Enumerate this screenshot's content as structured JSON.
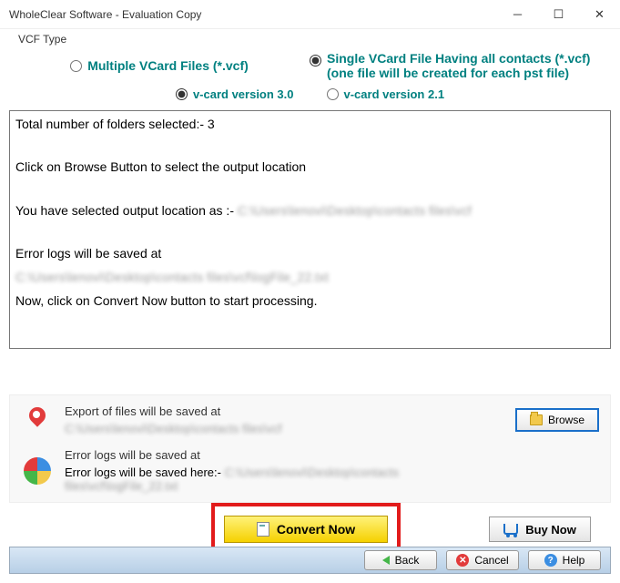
{
  "window": {
    "title": "WholeClear Software - Evaluation Copy"
  },
  "vcfType": {
    "groupLabel": "VCF Type",
    "multiple": "Multiple VCard Files (*.vcf)",
    "singleLine1": "Single VCard File Having all contacts (*.vcf)",
    "singleLine2": "(one file will be created for each pst file)"
  },
  "version": {
    "v30": "v-card version 3.0",
    "v21": "v-card version 2.1"
  },
  "log": {
    "l1": "Total number of folders selected:- 3",
    "l2": "Click on Browse Button to select the output location",
    "l3a": "You have selected output location as :- ",
    "l3b": "C:\\Users\\lenovi\\Desktop\\contacts files\\vcf",
    "l4": "Error logs will be saved at",
    "l5": "C:\\Users\\lenovi\\Desktop\\contacts files\\vcf\\logFile_22.txt",
    "l6": "Now, click on Convert Now button to start processing."
  },
  "export": {
    "label": "Export of files will be saved at",
    "path": "C:\\Users\\lenovi\\Desktop\\contacts files\\vcf",
    "browse": "Browse"
  },
  "errorlog": {
    "label": "Error logs will be saved at",
    "prefix": "Error logs will be saved here:- ",
    "path": "C:\\Users\\lenovi\\Desktop\\contacts files\\vcf\\logFile_22.txt"
  },
  "buttons": {
    "convert": "Convert Now",
    "buy": "Buy Now",
    "back": "Back",
    "cancel": "Cancel",
    "help": "Help"
  }
}
